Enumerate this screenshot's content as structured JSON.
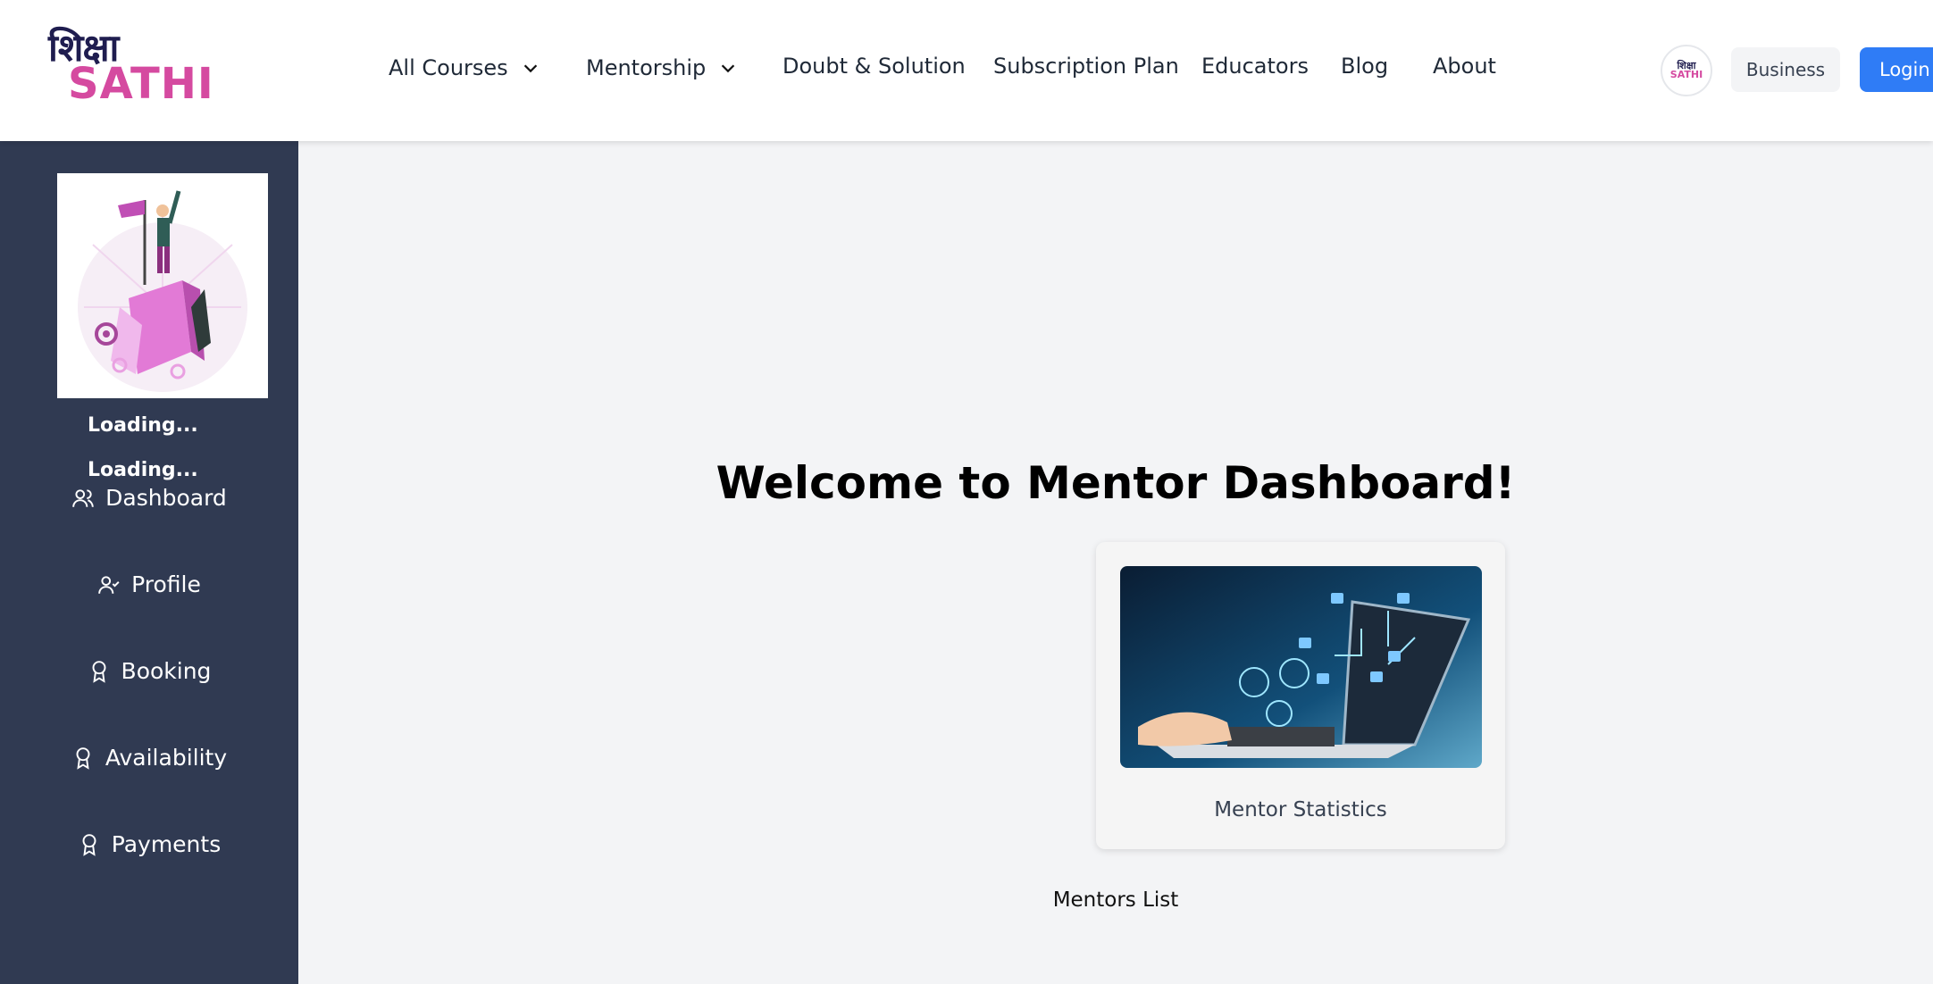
{
  "header": {
    "logo": {
      "hindi_text": "शिक्षा",
      "latin_text": "SATHI"
    },
    "nav": [
      {
        "label": "All Courses",
        "has_dropdown": true
      },
      {
        "label": "Mentorship",
        "has_dropdown": true
      },
      {
        "label": "Doubt & Solution",
        "has_dropdown": false
      },
      {
        "label": "Subscription Plan",
        "has_dropdown": false
      },
      {
        "label": "Educators",
        "has_dropdown": false
      },
      {
        "label": "Blog",
        "has_dropdown": false
      },
      {
        "label": "About",
        "has_dropdown": false
      }
    ],
    "avatar_mini": {
      "line1": "शिक्षा",
      "line2": "SATHI"
    },
    "business_label": "Business",
    "login_label": "Login"
  },
  "sidebar": {
    "name_text": "Loading...",
    "role_text": "Loading...",
    "items": [
      {
        "label": "Dashboard",
        "icon": "users-icon"
      },
      {
        "label": "Profile",
        "icon": "user-check-icon"
      },
      {
        "label": "Booking",
        "icon": "award-icon"
      },
      {
        "label": "Availability",
        "icon": "award-icon"
      },
      {
        "label": "Payments",
        "icon": "award-icon"
      }
    ]
  },
  "main": {
    "title": "Welcome to Mentor Dashboard!",
    "card_label": "Mentor Statistics",
    "mentors_list_label": "Mentors List"
  },
  "colors": {
    "sidebar_bg": "#303a52",
    "main_bg": "#f3f4f6",
    "login_blue": "#2f7cf6",
    "brand_pink": "#d54aa0",
    "brand_navy": "#1f1d4f"
  }
}
